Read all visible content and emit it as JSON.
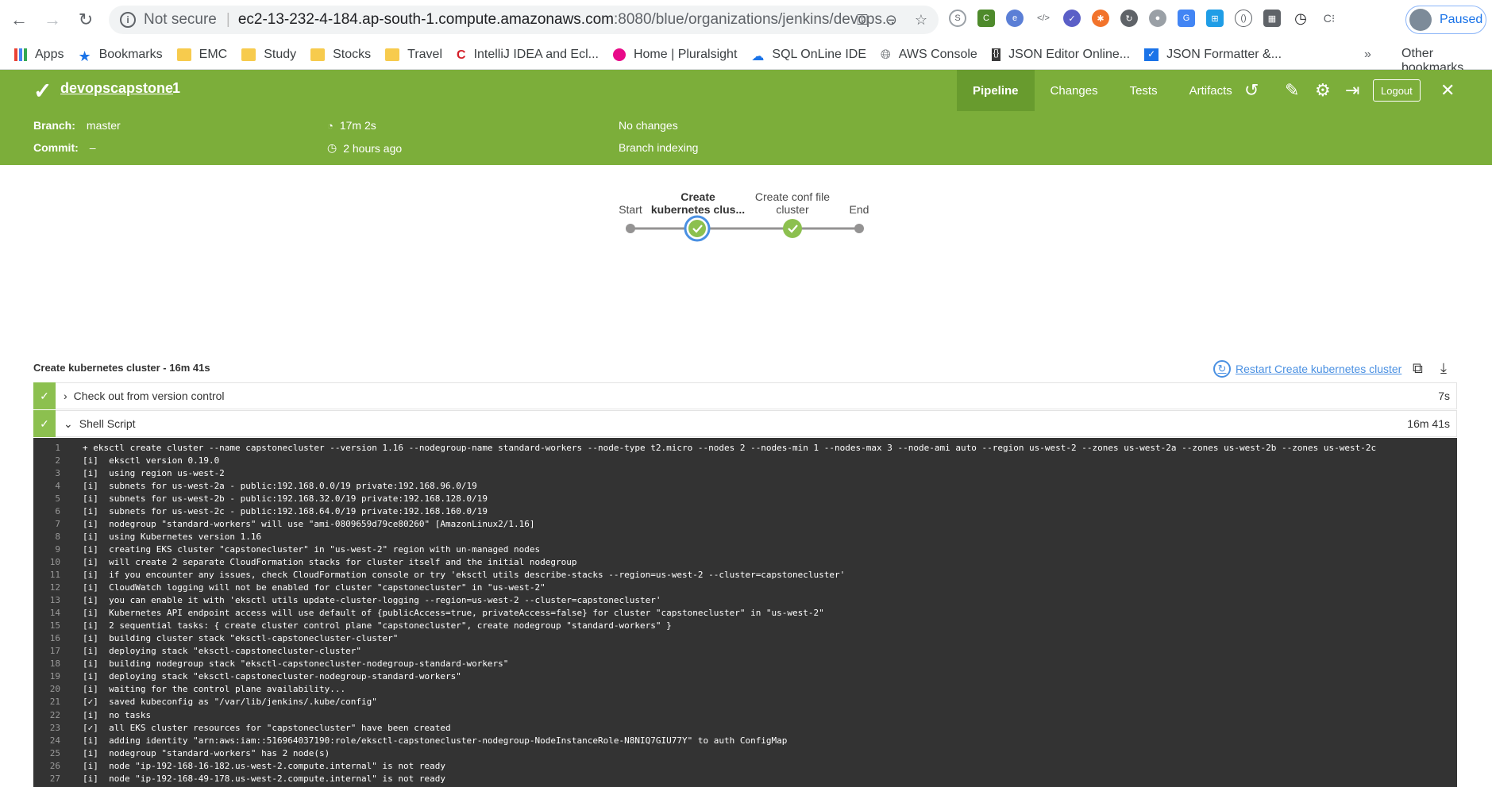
{
  "browser": {
    "url_notsecure": "Not secure",
    "url_host": "ec2-13-232-4-184.ap-south-1.compute.amazonaws.com",
    "url_path": ":8080/blue/organizations/jenkins/devops...",
    "profile_status": "Paused"
  },
  "bookmarks": {
    "items": [
      "Apps",
      "Bookmarks",
      "EMC",
      "Study",
      "Stocks",
      "Travel",
      "IntelliJ IDEA and Ecl...",
      "Home | Pluralsight",
      "SQL OnLine IDE",
      "AWS Console",
      "JSON Editor Online...",
      "JSON Formatter &..."
    ],
    "more": "»",
    "other": "Other bookmarks"
  },
  "header": {
    "pipeline_name": "devopscapstone",
    "run_number": "1",
    "tabs": [
      "Pipeline",
      "Changes",
      "Tests",
      "Artifacts"
    ],
    "logout": "Logout"
  },
  "summary": {
    "branch_label": "Branch:",
    "branch_value": "master",
    "commit_label": "Commit:",
    "commit_value": "–",
    "duration": "17m 2s",
    "started": "2 hours ago",
    "changes": "No changes",
    "cause": "Branch indexing"
  },
  "graph": {
    "stages": [
      {
        "line1": "Start",
        "line2": ""
      },
      {
        "line1": "Create",
        "line2": "kubernetes clus..."
      },
      {
        "line1": "Create conf file",
        "line2": "cluster"
      },
      {
        "line1": "End",
        "line2": ""
      }
    ]
  },
  "steps": {
    "title": "Create kubernetes cluster - 16m 41s",
    "restart": "Restart Create kubernetes cluster",
    "rows": [
      {
        "label": "Check out from version control",
        "duration": "7s"
      },
      {
        "label": "Shell Script",
        "duration": "16m 41s"
      }
    ]
  },
  "log": [
    "+ eksctl create cluster --name capstonecluster --version 1.16 --nodegroup-name standard-workers --node-type t2.micro --nodes 2 --nodes-min 1 --nodes-max 3 --node-ami auto --region us-west-2 --zones us-west-2a --zones us-west-2b --zones us-west-2c",
    "[i]  eksctl version 0.19.0",
    "[i]  using region us-west-2",
    "[i]  subnets for us-west-2a - public:192.168.0.0/19 private:192.168.96.0/19",
    "[i]  subnets for us-west-2b - public:192.168.32.0/19 private:192.168.128.0/19",
    "[i]  subnets for us-west-2c - public:192.168.64.0/19 private:192.168.160.0/19",
    "[i]  nodegroup \"standard-workers\" will use \"ami-0809659d79ce80260\" [AmazonLinux2/1.16]",
    "[i]  using Kubernetes version 1.16",
    "[i]  creating EKS cluster \"capstonecluster\" in \"us-west-2\" region with un-managed nodes",
    "[i]  will create 2 separate CloudFormation stacks for cluster itself and the initial nodegroup",
    "[i]  if you encounter any issues, check CloudFormation console or try 'eksctl utils describe-stacks --region=us-west-2 --cluster=capstonecluster'",
    "[i]  CloudWatch logging will not be enabled for cluster \"capstonecluster\" in \"us-west-2\"",
    "[i]  you can enable it with 'eksctl utils update-cluster-logging --region=us-west-2 --cluster=capstonecluster'",
    "[i]  Kubernetes API endpoint access will use default of {publicAccess=true, privateAccess=false} for cluster \"capstonecluster\" in \"us-west-2\"",
    "[i]  2 sequential tasks: { create cluster control plane \"capstonecluster\", create nodegroup \"standard-workers\" }",
    "[i]  building cluster stack \"eksctl-capstonecluster-cluster\"",
    "[i]  deploying stack \"eksctl-capstonecluster-cluster\"",
    "[i]  building nodegroup stack \"eksctl-capstonecluster-nodegroup-standard-workers\"",
    "[i]  deploying stack \"eksctl-capstonecluster-nodegroup-standard-workers\"",
    "[i]  waiting for the control plane availability...",
    "[✓]  saved kubeconfig as \"/var/lib/jenkins/.kube/config\"",
    "[i]  no tasks",
    "[✓]  all EKS cluster resources for \"capstonecluster\" have been created",
    "[i]  adding identity \"arn:aws:iam::516964037190:role/eksctl-capstonecluster-nodegroup-NodeInstanceRole-N8NIQ7GIU77Y\" to auth ConfigMap",
    "[i]  nodegroup \"standard-workers\" has 2 node(s)",
    "[i]  node \"ip-192-168-16-182.us-west-2.compute.internal\" is not ready",
    "[i]  node \"ip-192-168-49-178.us-west-2.compute.internal\" is not ready"
  ],
  "colors": {
    "jenkins_green": "#7cae3a",
    "success": "#8cc04f",
    "selected_ring": "#4a90e2",
    "log_bg": "#333333"
  }
}
